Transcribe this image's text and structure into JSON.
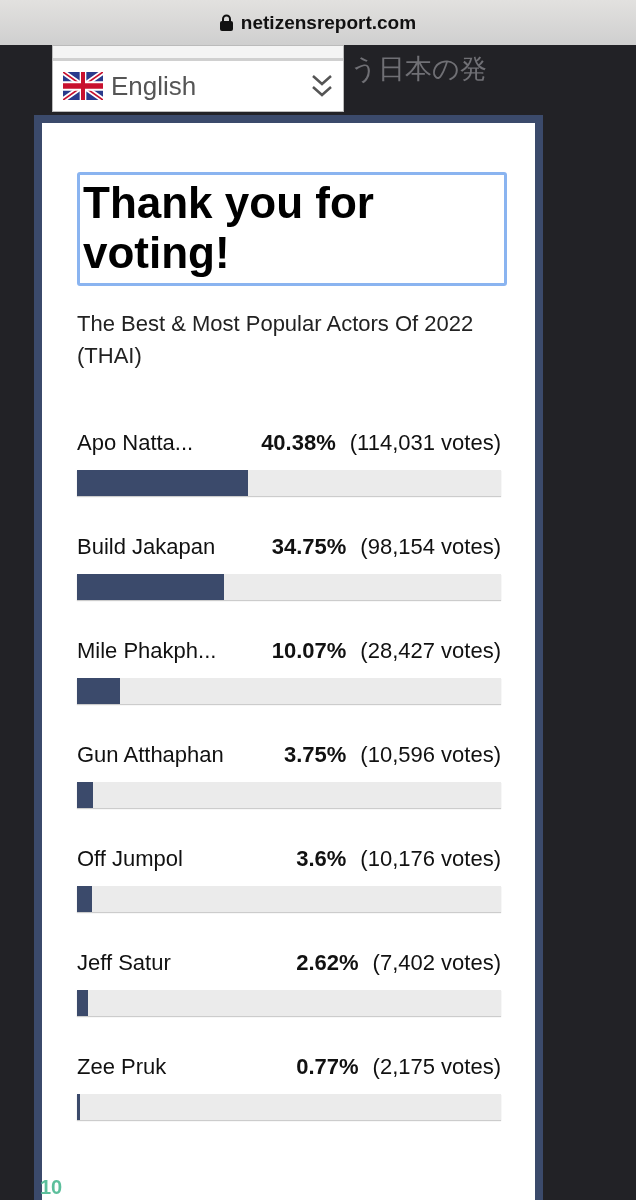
{
  "address_bar": {
    "url": "netizensreport.com"
  },
  "background_heading": "う日本の発",
  "language_dropdown": {
    "value": "English"
  },
  "poll": {
    "title": "Thank you for voting!",
    "question": "The Best & Most Popular Actors Of 2022 (THAI)",
    "options": [
      {
        "name": "Apo Natta...",
        "percent": "40.38%",
        "votes": "(114,031 votes)",
        "level": 0.4038
      },
      {
        "name": "Build Jakapan",
        "percent": "34.75%",
        "votes": "(98,154 votes)",
        "level": 0.3475
      },
      {
        "name": "Mile Phakph...",
        "percent": "10.07%",
        "votes": "(28,427 votes)",
        "level": 0.1007
      },
      {
        "name": "Gun Atthaphan",
        "percent": "3.75%",
        "votes": "(10,596 votes)",
        "level": 0.0375
      },
      {
        "name": "Off Jumpol",
        "percent": "3.6%",
        "votes": "(10,176 votes)",
        "level": 0.036
      },
      {
        "name": "Jeff Satur",
        "percent": "2.62%",
        "votes": "(7,402 votes)",
        "level": 0.0262
      },
      {
        "name": "Zee Pruk",
        "percent": "0.77%",
        "votes": "(2,175 votes)",
        "level": 0.0077
      }
    ]
  },
  "corner_badge": "10"
}
